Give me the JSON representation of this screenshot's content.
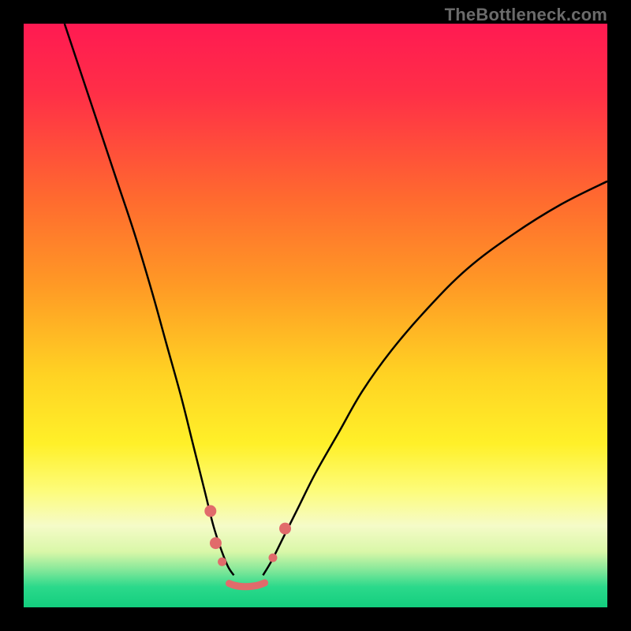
{
  "watermark": "TheBottleneck.com",
  "chart_data": {
    "type": "line",
    "title": "",
    "xlabel": "",
    "ylabel": "",
    "xlim": [
      0,
      100
    ],
    "ylim": [
      0,
      100
    ],
    "grid": false,
    "legend": false,
    "background_gradient": {
      "stops": [
        {
          "t": 0.0,
          "color": "#ff1a52"
        },
        {
          "t": 0.12,
          "color": "#ff2f47"
        },
        {
          "t": 0.3,
          "color": "#ff6a2f"
        },
        {
          "t": 0.45,
          "color": "#ff9a25"
        },
        {
          "t": 0.6,
          "color": "#ffd223"
        },
        {
          "t": 0.72,
          "color": "#fff029"
        },
        {
          "t": 0.8,
          "color": "#fdfc7a"
        },
        {
          "t": 0.86,
          "color": "#f5fbc8"
        },
        {
          "t": 0.905,
          "color": "#d9f7a8"
        },
        {
          "t": 0.935,
          "color": "#87e89a"
        },
        {
          "t": 0.965,
          "color": "#2bd98b"
        },
        {
          "t": 1.0,
          "color": "#13ce7e"
        }
      ]
    },
    "series": [
      {
        "name": "left-curve",
        "color": "#000000",
        "width": 2.5,
        "x": [
          7,
          10,
          13,
          16,
          19,
          22,
          24.5,
          27,
          29,
          31,
          32.5,
          33.8,
          35,
          36
        ],
        "y": [
          100,
          91,
          82,
          73,
          64,
          54,
          45,
          36,
          28,
          20,
          14,
          10,
          7,
          5.5
        ]
      },
      {
        "name": "right-curve",
        "color": "#000000",
        "width": 2.5,
        "x": [
          41,
          42.5,
          44.5,
          47,
          50,
          54,
          58,
          63,
          69,
          76,
          84,
          92,
          100
        ],
        "y": [
          5.5,
          8,
          12,
          17,
          23,
          30,
          37,
          44,
          51,
          58,
          64,
          69,
          73
        ]
      },
      {
        "name": "valley-floor",
        "color": "#e16b6b",
        "width": 9,
        "linecap": "round",
        "x": [
          35.2,
          36.0,
          37.0,
          38.0,
          39.0,
          40.2,
          41.3
        ],
        "y": [
          4.1,
          3.8,
          3.6,
          3.55,
          3.6,
          3.8,
          4.2
        ]
      }
    ],
    "markers": [
      {
        "name": "left-marker-1",
        "x": 32.0,
        "y": 16.5,
        "r": 7.5,
        "color": "#e16b6b"
      },
      {
        "name": "left-marker-2",
        "x": 32.9,
        "y": 11.0,
        "r": 7.5,
        "color": "#e16b6b"
      },
      {
        "name": "left-marker-3",
        "x": 34.0,
        "y": 7.8,
        "r": 5.5,
        "color": "#e16b6b"
      },
      {
        "name": "right-marker-1",
        "x": 42.7,
        "y": 8.5,
        "r": 5.5,
        "color": "#e16b6b"
      },
      {
        "name": "right-marker-2",
        "x": 44.8,
        "y": 13.5,
        "r": 7.5,
        "color": "#e16b6b"
      }
    ]
  }
}
